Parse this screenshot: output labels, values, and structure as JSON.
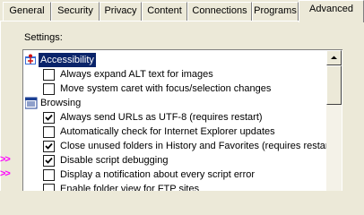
{
  "tabs": [
    {
      "label": "General"
    },
    {
      "label": "Security"
    },
    {
      "label": "Privacy"
    },
    {
      "label": "Content"
    },
    {
      "label": "Connections"
    },
    {
      "label": "Programs"
    },
    {
      "label": "Advanced",
      "active": true
    }
  ],
  "settings_label": "Settings:",
  "settings": [
    {
      "type": "category",
      "icon": "accessibility-icon",
      "label": "Accessibility",
      "selected": true
    },
    {
      "type": "option",
      "label": "Always expand ALT text for images",
      "checked": false
    },
    {
      "type": "option",
      "label": "Move system caret with focus/selection changes",
      "checked": false
    },
    {
      "type": "category",
      "icon": "browsing-icon",
      "label": "Browsing",
      "selected": false
    },
    {
      "type": "option",
      "label": "Always send URLs as UTF-8 (requires restart)",
      "checked": true
    },
    {
      "type": "option",
      "label": "Automatically check for Internet Explorer updates",
      "checked": false
    },
    {
      "type": "option",
      "label": "Close unused folders in History and Favorites (requires restart)",
      "checked": true
    },
    {
      "type": "option",
      "label": "Disable script debugging",
      "checked": true,
      "marker": ">>"
    },
    {
      "type": "option",
      "label": "Display a notification about every script error",
      "checked": false,
      "marker": ">>"
    },
    {
      "type": "option",
      "label": "Enable folder view for FTP sites",
      "checked": false
    }
  ],
  "colors": {
    "marker": "#ff00ff",
    "selection": "#0a246a",
    "window_bg": "#ece9d8"
  }
}
